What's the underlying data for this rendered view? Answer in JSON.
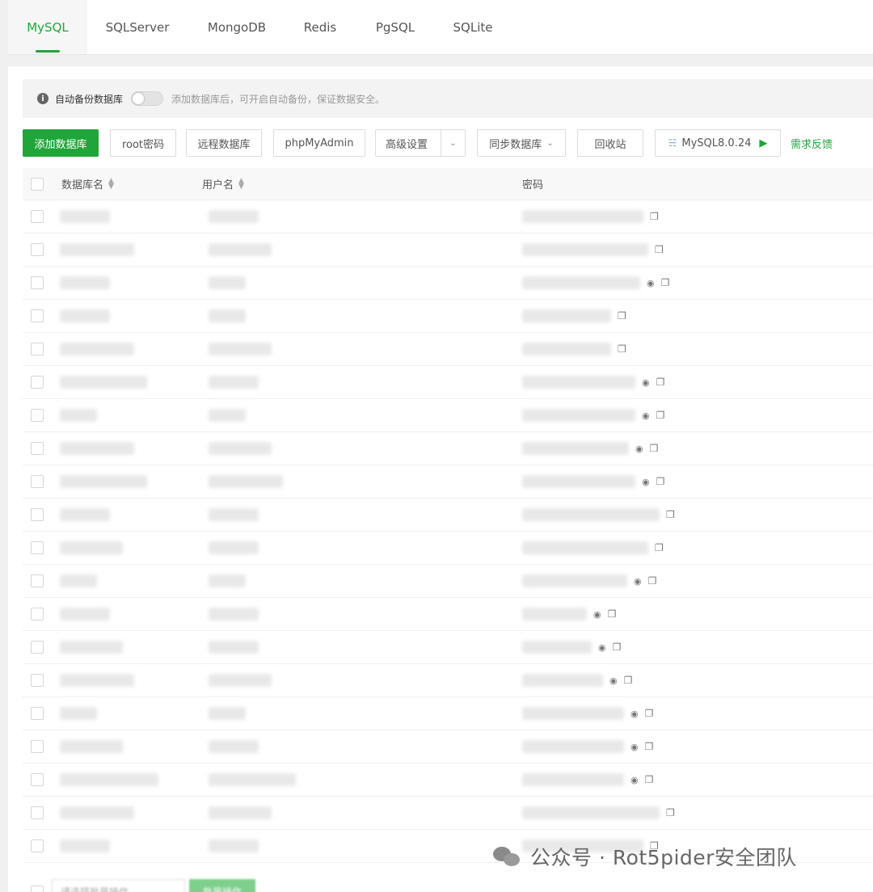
{
  "tabs": [
    {
      "label": "MySQL",
      "active": true
    },
    {
      "label": "SQLServer",
      "active": false
    },
    {
      "label": "MongoDB",
      "active": false
    },
    {
      "label": "Redis",
      "active": false
    },
    {
      "label": "PgSQL",
      "active": false
    },
    {
      "label": "SQLite",
      "active": false
    }
  ],
  "notice": {
    "label": "自动备份数据库",
    "hint": "添加数据库后，可开启自动备份，保证数据安全。",
    "toggle_on": false
  },
  "toolbar": {
    "add_db": "添加数据库",
    "root_password": "root密码",
    "remote_db": "远程数据库",
    "phpmyadmin": "phpMyAdmin",
    "advanced": "高级设置",
    "sync_db": "同步数据库",
    "recycle_bin": "回收站",
    "version": "MySQL8.0.24",
    "feedback": "需求反馈"
  },
  "table": {
    "columns": [
      "数据库名",
      "用户名",
      "密码"
    ],
    "row_count": 20
  },
  "pager": {
    "batch_placeholder": "请选择批量操作",
    "batch_button": "批量操作"
  },
  "watermark": "公众号 · Rot5pider安全团队",
  "colors": {
    "accent": "#20a53a"
  }
}
